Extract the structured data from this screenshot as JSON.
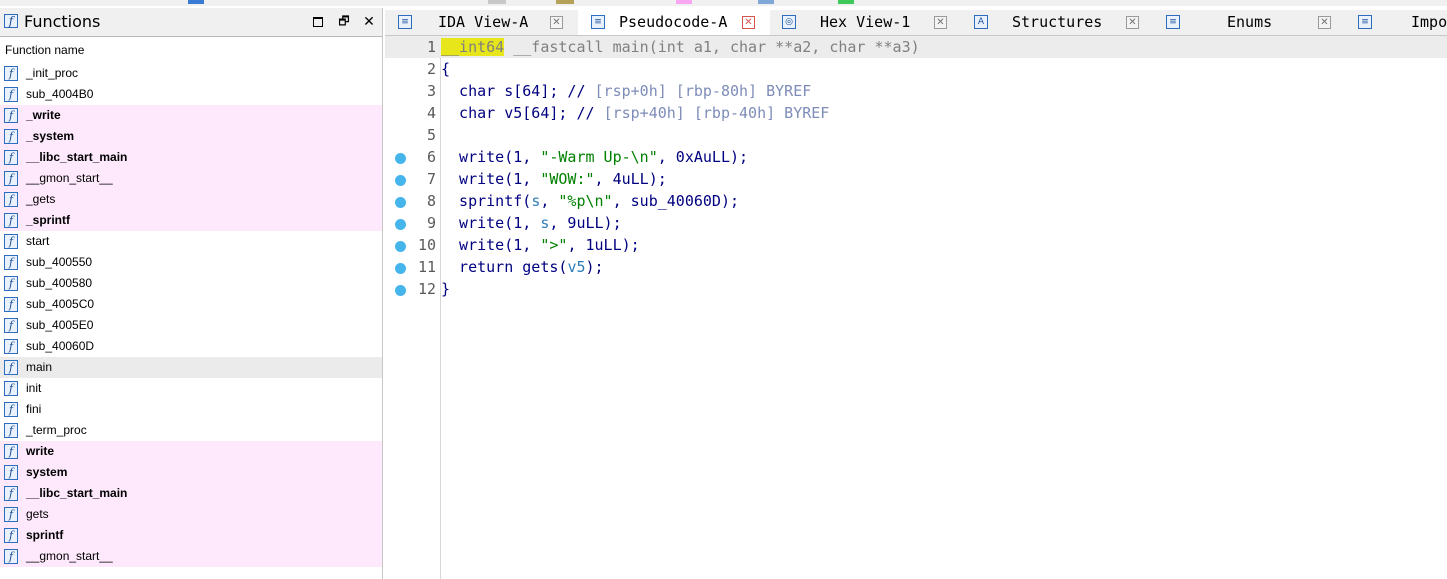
{
  "window": {
    "functions_panel": {
      "title": "Functions",
      "column_header": "Function name",
      "buttons": {
        "minimize": "",
        "float": "🗗",
        "close": "✕"
      },
      "functions": [
        {
          "name": "_init_proc",
          "library": false,
          "bold": false,
          "selected": false
        },
        {
          "name": "sub_4004B0",
          "library": false,
          "bold": false,
          "selected": false
        },
        {
          "name": "_write",
          "library": true,
          "bold": true,
          "selected": false
        },
        {
          "name": "_system",
          "library": true,
          "bold": true,
          "selected": false
        },
        {
          "name": "__libc_start_main",
          "library": true,
          "bold": true,
          "selected": false
        },
        {
          "name": "__gmon_start__",
          "library": true,
          "bold": false,
          "selected": false
        },
        {
          "name": "_gets",
          "library": true,
          "bold": false,
          "selected": false
        },
        {
          "name": "_sprintf",
          "library": true,
          "bold": true,
          "selected": false
        },
        {
          "name": "start",
          "library": false,
          "bold": false,
          "selected": false
        },
        {
          "name": "sub_400550",
          "library": false,
          "bold": false,
          "selected": false
        },
        {
          "name": "sub_400580",
          "library": false,
          "bold": false,
          "selected": false
        },
        {
          "name": "sub_4005C0",
          "library": false,
          "bold": false,
          "selected": false
        },
        {
          "name": "sub_4005E0",
          "library": false,
          "bold": false,
          "selected": false
        },
        {
          "name": "sub_40060D",
          "library": false,
          "bold": false,
          "selected": false
        },
        {
          "name": "main",
          "library": false,
          "bold": false,
          "selected": true
        },
        {
          "name": "init",
          "library": false,
          "bold": false,
          "selected": false
        },
        {
          "name": "fini",
          "library": false,
          "bold": false,
          "selected": false
        },
        {
          "name": "_term_proc",
          "library": false,
          "bold": false,
          "selected": false
        },
        {
          "name": "write",
          "library": true,
          "bold": true,
          "selected": false
        },
        {
          "name": "system",
          "library": true,
          "bold": true,
          "selected": false
        },
        {
          "name": "__libc_start_main",
          "library": true,
          "bold": true,
          "selected": false
        },
        {
          "name": "gets",
          "library": true,
          "bold": false,
          "selected": false
        },
        {
          "name": "sprintf",
          "library": true,
          "bold": true,
          "selected": false
        },
        {
          "name": "__gmon_start__",
          "library": true,
          "bold": false,
          "selected": false
        }
      ]
    },
    "tabs": [
      {
        "label": "IDA View-A",
        "icon": "ida-view-icon",
        "active": false
      },
      {
        "label": "Pseudocode-A",
        "icon": "pseudocode-icon",
        "active": true
      },
      {
        "label": "Hex View-1",
        "icon": "hex-view-icon",
        "active": false
      },
      {
        "label": "Structures",
        "icon": "structures-icon",
        "active": false
      },
      {
        "label": "Enums",
        "icon": "enums-icon",
        "active": false
      },
      {
        "label": "Impo",
        "icon": "imports-icon",
        "active": false
      }
    ],
    "tab_close_glyph": "✕",
    "pseudocode": {
      "lines": [
        {
          "num": "1",
          "breakpoint": false,
          "tokens": [
            {
              "t": "__int64",
              "c": "kwhl"
            },
            {
              "t": " __fastcall main(int a1, char **a2, char **a3)",
              "c": "c-gray"
            }
          ]
        },
        {
          "num": "2",
          "breakpoint": false,
          "tokens": [
            {
              "t": "{",
              "c": "c-navy"
            }
          ]
        },
        {
          "num": "3",
          "breakpoint": false,
          "tokens": [
            {
              "t": "  char s[64]; // ",
              "c": "c-navy"
            },
            {
              "t": "[rsp+0h] [rbp-80h] BYREF",
              "c": "c-cmt"
            }
          ]
        },
        {
          "num": "4",
          "breakpoint": false,
          "tokens": [
            {
              "t": "  char v5[64]; // ",
              "c": "c-navy"
            },
            {
              "t": "[rsp+40h] [rbp-40h] BYREF",
              "c": "c-cmt"
            }
          ]
        },
        {
          "num": "5",
          "breakpoint": false,
          "tokens": []
        },
        {
          "num": "6",
          "breakpoint": true,
          "tokens": [
            {
              "t": "  write(1, ",
              "c": "c-navy"
            },
            {
              "t": "\"-Warm Up-\\n\"",
              "c": "c-green"
            },
            {
              "t": ", 0xAuLL);",
              "c": "c-navy"
            }
          ]
        },
        {
          "num": "7",
          "breakpoint": true,
          "tokens": [
            {
              "t": "  write(1, ",
              "c": "c-navy"
            },
            {
              "t": "\"WOW:\"",
              "c": "c-green"
            },
            {
              "t": ", 4uLL);",
              "c": "c-navy"
            }
          ]
        },
        {
          "num": "8",
          "breakpoint": true,
          "tokens": [
            {
              "t": "  sprintf(",
              "c": "c-navy"
            },
            {
              "t": "s",
              "c": "c-blue"
            },
            {
              "t": ", ",
              "c": "c-navy"
            },
            {
              "t": "\"%p\\n\"",
              "c": "c-green"
            },
            {
              "t": ", sub_40060D);",
              "c": "c-navy"
            }
          ]
        },
        {
          "num": "9",
          "breakpoint": true,
          "tokens": [
            {
              "t": "  write(1, ",
              "c": "c-navy"
            },
            {
              "t": "s",
              "c": "c-blue"
            },
            {
              "t": ", 9uLL);",
              "c": "c-navy"
            }
          ]
        },
        {
          "num": "10",
          "breakpoint": true,
          "tokens": [
            {
              "t": "  write(1, ",
              "c": "c-navy"
            },
            {
              "t": "\">\"",
              "c": "c-green"
            },
            {
              "t": ", 1uLL);",
              "c": "c-navy"
            }
          ]
        },
        {
          "num": "11",
          "breakpoint": true,
          "tokens": [
            {
              "t": "  return gets(",
              "c": "c-navy"
            },
            {
              "t": "v5",
              "c": "c-blue"
            },
            {
              "t": ");",
              "c": "c-navy"
            }
          ]
        },
        {
          "num": "12",
          "breakpoint": true,
          "tokens": [
            {
              "t": "}",
              "c": "c-navy"
            }
          ]
        }
      ]
    }
  },
  "colors": {
    "library_row": "#fde9fb",
    "selected_row": "#ebebeb",
    "breakpoint": "#45b5ec",
    "keyword_highlight": "#e6e61a"
  }
}
